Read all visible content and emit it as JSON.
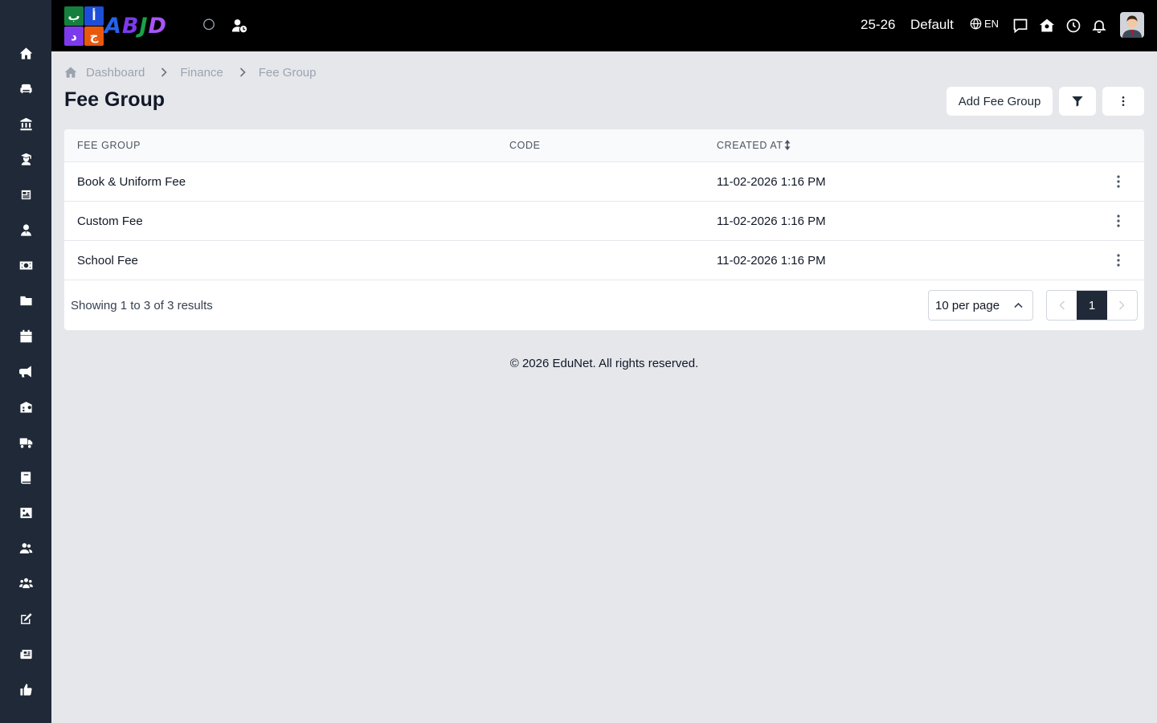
{
  "app": {
    "logo_grid": [
      "ب",
      "أ",
      "د",
      "ج"
    ],
    "logo_text": [
      "A",
      "B",
      "J",
      "D"
    ]
  },
  "sidebar": {
    "items": [
      {
        "icon": "home-icon"
      },
      {
        "icon": "sofa-icon"
      },
      {
        "icon": "bank-icon"
      },
      {
        "icon": "student-icon"
      },
      {
        "icon": "news-icon"
      },
      {
        "icon": "user-tie-icon"
      },
      {
        "icon": "money-bill-icon"
      },
      {
        "icon": "folder-icon"
      },
      {
        "icon": "calendar-icon"
      },
      {
        "icon": "megaphone-icon"
      },
      {
        "icon": "school-icon"
      },
      {
        "icon": "truck-icon"
      },
      {
        "icon": "book-icon"
      },
      {
        "icon": "image-icon"
      },
      {
        "icon": "users-icon"
      },
      {
        "icon": "group-icon"
      },
      {
        "icon": "edit-icon"
      },
      {
        "icon": "newspaper-icon"
      },
      {
        "icon": "thumbs-up-icon"
      }
    ]
  },
  "topbar": {
    "session": "25-26",
    "profile": "Default",
    "language": "EN"
  },
  "breadcrumb": {
    "items": [
      "Dashboard",
      "Finance",
      "Fee Group"
    ]
  },
  "page": {
    "title": "Fee Group",
    "add_button": "Add Fee Group"
  },
  "table": {
    "headers": [
      "FEE GROUP",
      "CODE",
      "CREATED AT"
    ],
    "rows": [
      {
        "fee_group": "Book & Uniform Fee",
        "code": "",
        "created_at": "11-02-2026 1:16 PM"
      },
      {
        "fee_group": "Custom Fee",
        "code": "",
        "created_at": "11-02-2026 1:16 PM"
      },
      {
        "fee_group": "School Fee",
        "code": "",
        "created_at": "11-02-2026 1:16 PM"
      }
    ],
    "summary": "Showing 1 to 3 of 3 results",
    "per_page": "10 per page",
    "current_page": "1"
  },
  "footer": {
    "copyright": "© 2026 EduNet. All rights reserved."
  },
  "colors": {
    "sidebar_bg": "#1f2937",
    "topbar_bg": "#000000",
    "page_bg": "#e5e7eb",
    "active_page": "#1f2937"
  }
}
